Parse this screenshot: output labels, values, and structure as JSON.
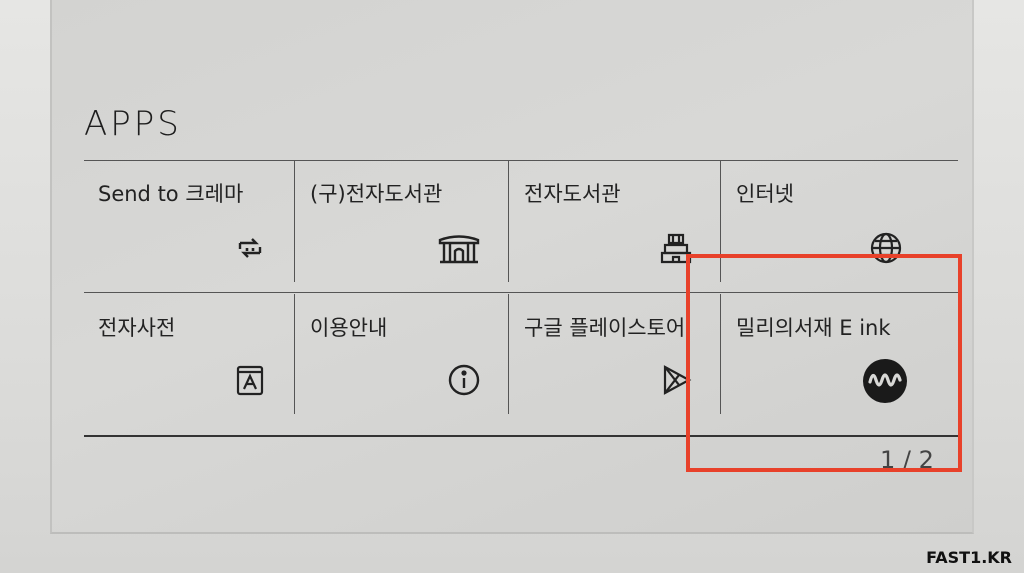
{
  "header": {
    "title": "APPS"
  },
  "apps": [
    {
      "label": "Send to 크레마",
      "icon": "send-sync-icon"
    },
    {
      "label": "(구)전자도서관",
      "icon": "library-building-icon"
    },
    {
      "label": "전자도서관",
      "icon": "library-castle-icon"
    },
    {
      "label": "인터넷",
      "icon": "globe-icon"
    },
    {
      "label": "전자사전",
      "icon": "dictionary-icon"
    },
    {
      "label": "이용안내",
      "icon": "info-icon"
    },
    {
      "label": "구글 플레이스토어",
      "icon": "play-store-icon"
    },
    {
      "label": "밀리의서재 E ink",
      "icon": "millie-wave-icon"
    }
  ],
  "pagination": {
    "text": "1 / 2",
    "current": 1,
    "total": 2
  },
  "annotation": {
    "highlight_color": "#e8412a"
  },
  "watermark": "FAST1.KR"
}
